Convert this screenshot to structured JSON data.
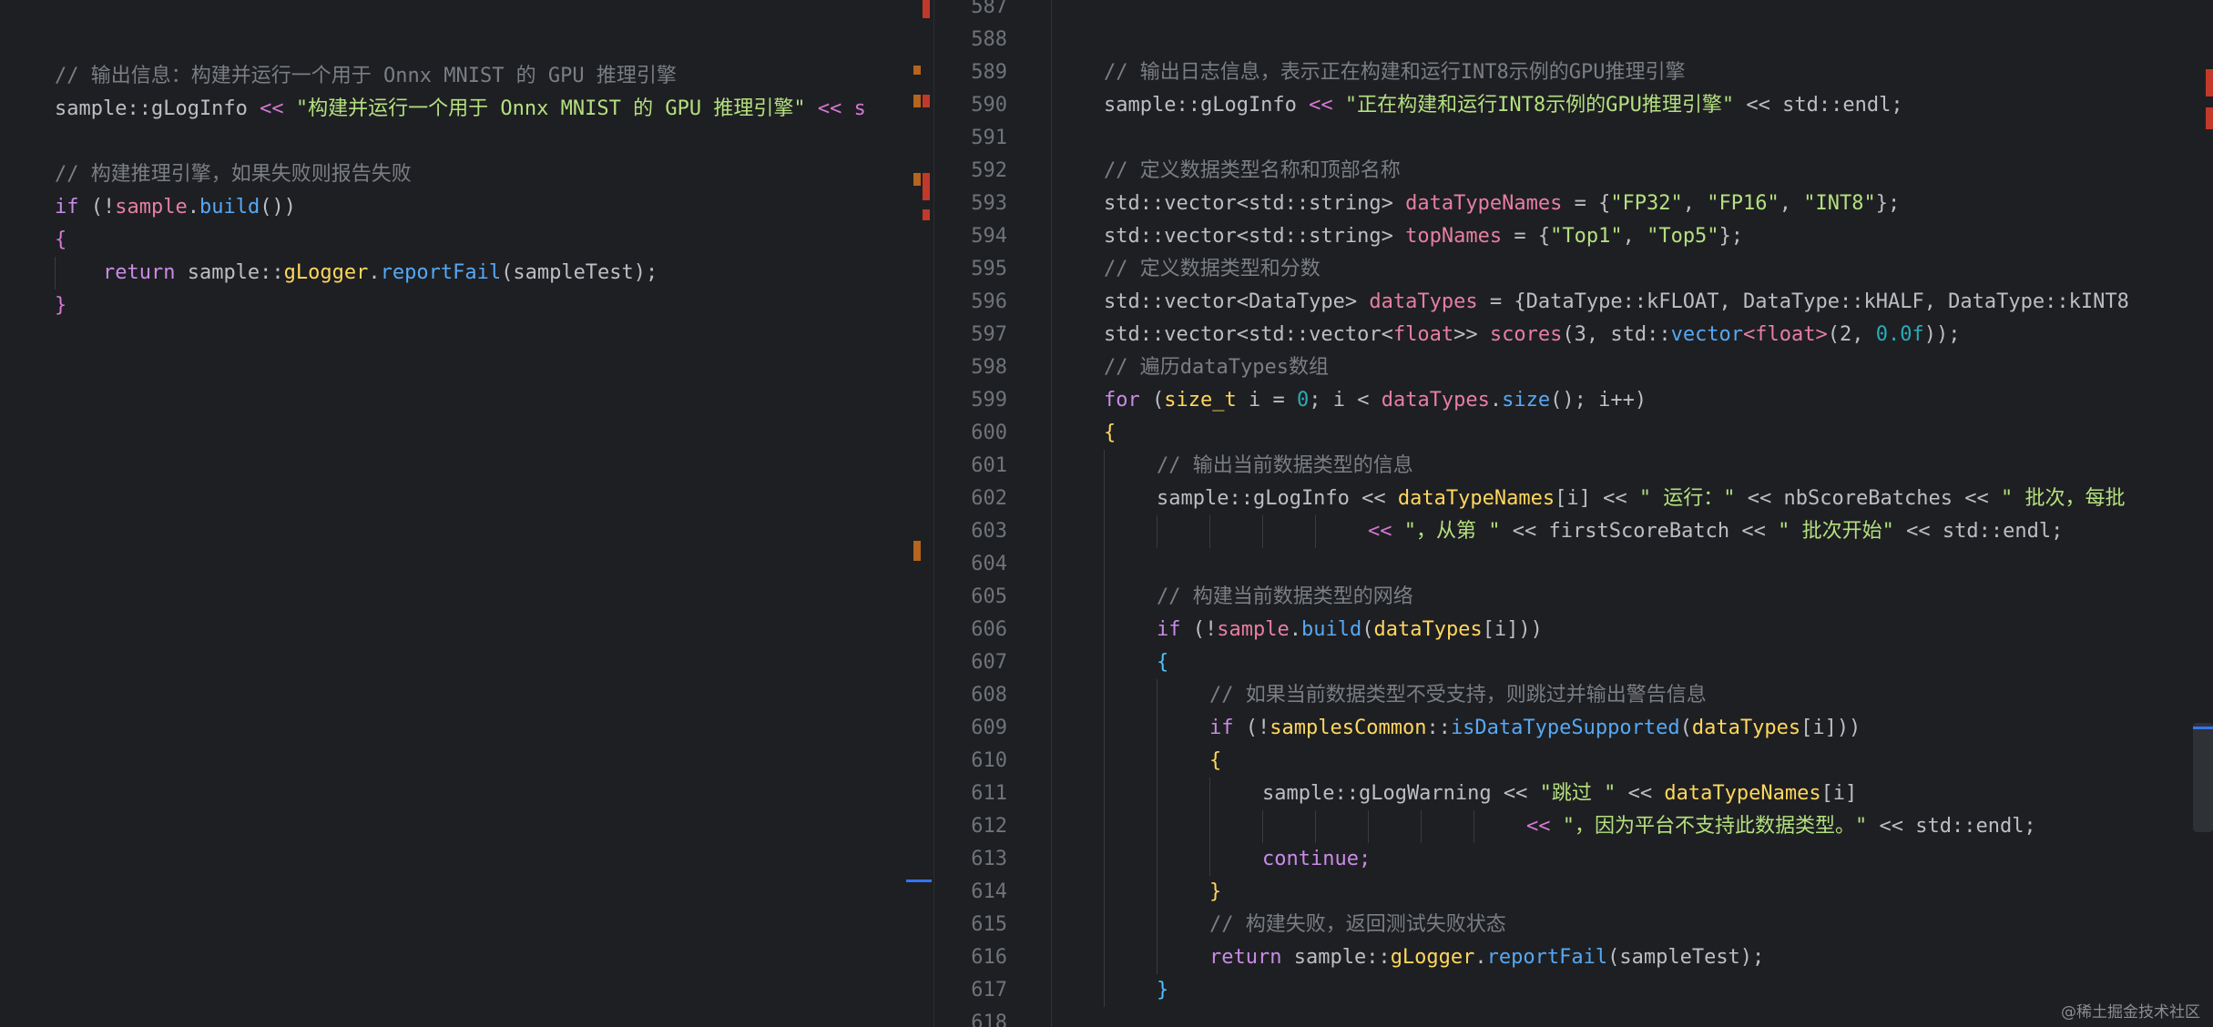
{
  "left_editor": {
    "lines": [
      {
        "kind": "comment",
        "text": "// 输出信息：构建并运行一个用于 Onnx MNIST 的 GPU 推理引擎"
      },
      {
        "kind": "code",
        "a": "sample::gLogInfo ",
        "b": "<< ",
        "c": "\"构建并运行一个用于 Onnx MNIST 的 GPU 推理引擎\"",
        "d": " << s"
      },
      {
        "kind": "blank",
        "text": ""
      },
      {
        "kind": "comment",
        "text": "// 构建推理引擎，如果失败则报告失败"
      },
      {
        "kind": "code",
        "a": "if",
        "b": " (!",
        "c": "sample",
        "d": ".",
        "e": "build",
        "f": "())"
      },
      {
        "kind": "code",
        "a": "{"
      },
      {
        "kind": "code",
        "a": "    return ",
        "b": "sample::",
        "c": "gLogger",
        "d": ".",
        "e": "reportFail",
        "f": "(sampleTest);"
      },
      {
        "kind": "code",
        "a": "}"
      }
    ]
  },
  "right_editor": {
    "line_numbers": [
      "587",
      "588",
      "589",
      "590",
      "591",
      "592",
      "593",
      "594",
      "595",
      "596",
      "597",
      "598",
      "599",
      "600",
      "601",
      "602",
      "603",
      "604",
      "605",
      "606",
      "607",
      "608",
      "609",
      "610",
      "611",
      "612",
      "613",
      "614",
      "615",
      "616",
      "617",
      "618"
    ],
    "lines": {
      "l587": "",
      "l588": "",
      "l589": "// 输出日志信息，表示正在构建和运行INT8示例的GPU推理引擎",
      "l590a": "sample::gLogInfo ",
      "l590b": "<< ",
      "l590c": "\"正在构建和运行INT8示例的GPU推理引擎\"",
      "l590d": " << std::endl;",
      "l592": "// 定义数据类型名称和顶部名称",
      "l593a": "std::vector<std::string> ",
      "l593b": "dataTypeNames",
      "l593c": " = {",
      "l593d": "\"FP32\"",
      "l593e": ", ",
      "l593f": "\"FP16\"",
      "l593g": ", ",
      "l593h": "\"INT8\"",
      "l593i": "};",
      "l594a": "std::vector<std::string> ",
      "l594b": "topNames",
      "l594c": " = {",
      "l594d": "\"Top1\"",
      "l594e": ", ",
      "l594f": "\"Top5\"",
      "l594g": "};",
      "l595": "// 定义数据类型和分数",
      "l596a": "std::vector<DataType> ",
      "l596b": "dataTypes",
      "l596c": " = {DataType::kFLOAT, DataType::kHALF, DataType::kINT8",
      "l597a": "std::vector<std::vector<",
      "l597b": "float",
      "l597c": ">> ",
      "l597d": "scores",
      "l597e": "(3, std::",
      "l597f": "vector",
      "l597g": "<float>",
      "l597h": "(2, ",
      "l597i": "0.0f",
      "l597j": "));",
      "l598": "// 遍历dataTypes数组",
      "l599a": "for",
      "l599b": " (",
      "l599c": "size_t",
      "l599d": " i = ",
      "l599e": "0",
      "l599f": "; i < ",
      "l599g": "dataTypes",
      "l599h": ".",
      "l599i": "size",
      "l599j": "(); i++)",
      "l600": "{",
      "l601": "// 输出当前数据类型的信息",
      "l602a": "sample::gLogInfo << ",
      "l602b": "dataTypeNames",
      "l602c": "[i] << ",
      "l602d": "\" 运行：\"",
      "l602e": " << nbScoreBatches << ",
      "l602f": "\" 批次，每批",
      "l603a": "<< ",
      "l603b": "\"，从第 \"",
      "l603c": " << firstScoreBatch << ",
      "l603d": "\" 批次开始\"",
      "l603e": " << std::endl;",
      "l605": "// 构建当前数据类型的网络",
      "l606a": "if",
      "l606b": " (!",
      "l606c": "sample",
      "l606d": ".",
      "l606e": "build",
      "l606f": "(",
      "l606g": "dataTypes",
      "l606h": "[i]))",
      "l607": "{",
      "l608": "// 如果当前数据类型不受支持，则跳过并输出警告信息",
      "l609a": "if",
      "l609b": " (!",
      "l609c": "samplesCommon",
      "l609d": "::",
      "l609e": "isDataTypeSupported",
      "l609f": "(",
      "l609g": "dataTypes",
      "l609h": "[i]))",
      "l610": "{",
      "l611a": "sample::gLogWarning << ",
      "l611b": "\"跳过 \"",
      "l611c": " << ",
      "l611d": "dataTypeNames",
      "l611e": "[i]",
      "l612a": "<< ",
      "l612b": "\"，因为平台不支持此数据类型。\"",
      "l612c": " << std::endl;",
      "l613": "continue;",
      "l614": "}",
      "l615": "// 构建失败，返回测试失败状态",
      "l616a": "return ",
      "l616b": "sample::",
      "l616c": "gLogger",
      "l616d": ".",
      "l616e": "reportFail",
      "l616f": "(sampleTest);",
      "l617": "}"
    }
  },
  "watermark": "@稀土掘金技术社区",
  "colors": {
    "background": "#1e1f22",
    "comment": "#7a7e85",
    "string": "#6aab73",
    "keyword": "#c98be8",
    "function": "#56a8f5",
    "variable": "#e67fa1",
    "type": "#ffd75e",
    "error_marker": "#c0392b",
    "warning_marker": "#b5651d"
  }
}
